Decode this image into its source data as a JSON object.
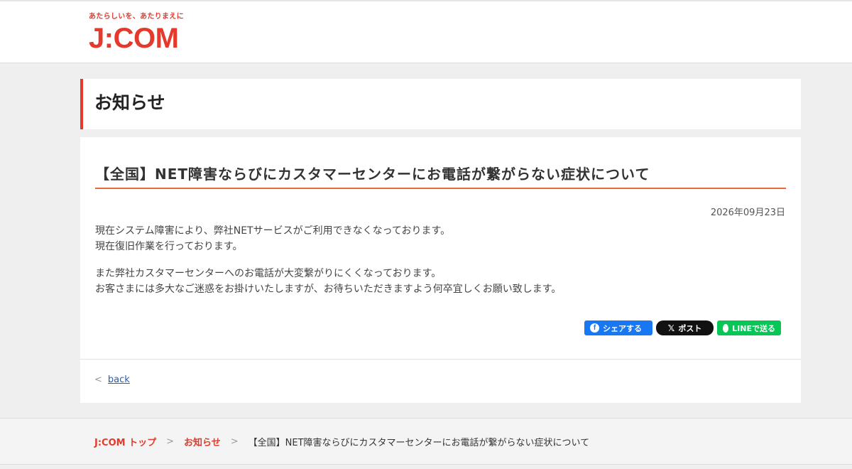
{
  "header": {
    "tagline": "あたらしいを、あたりまえに",
    "logo_text": "J:COM"
  },
  "page": {
    "title": "お知らせ"
  },
  "article": {
    "title": "【全国】NET障害ならびにカスタマーセンターにお電話が繋がらない症状について",
    "date": "2026年09月23日",
    "paragraph1": [
      "現在システム障害により、弊社NETサービスがご利用できなくなっております。",
      "現在復旧作業を行っております。"
    ],
    "paragraph2": [
      "また弊社カスタマーセンターへのお電話が大変繋がりにくくなっております。",
      "お客さまには多大なご迷惑をお掛けいたしますが、お待ちいただきますよう何卒宜しくお願い致します。"
    ]
  },
  "share": {
    "facebook_label": "シェアする",
    "x_label": "ポスト",
    "line_label": "LINEで送る",
    "facebook_icon": "facebook-icon",
    "x_icon": "x-icon",
    "line_icon": "line-icon"
  },
  "nav": {
    "back_label": "back",
    "back_icon": "chevron-left-icon"
  },
  "breadcrumb": {
    "items": [
      "J:COM トップ",
      "お知らせ"
    ],
    "current": "【全国】NET障害ならびにカスタマーセンターにお電話が繋がらない症状について",
    "separator_icon": "chevron-right-icon"
  },
  "colors": {
    "brand": "#e5392b",
    "title_rule": "#e56a3c",
    "facebook": "#1877f2",
    "x": "#111111",
    "line": "#06c755",
    "link": "#2a5db0",
    "background": "#efefef"
  }
}
